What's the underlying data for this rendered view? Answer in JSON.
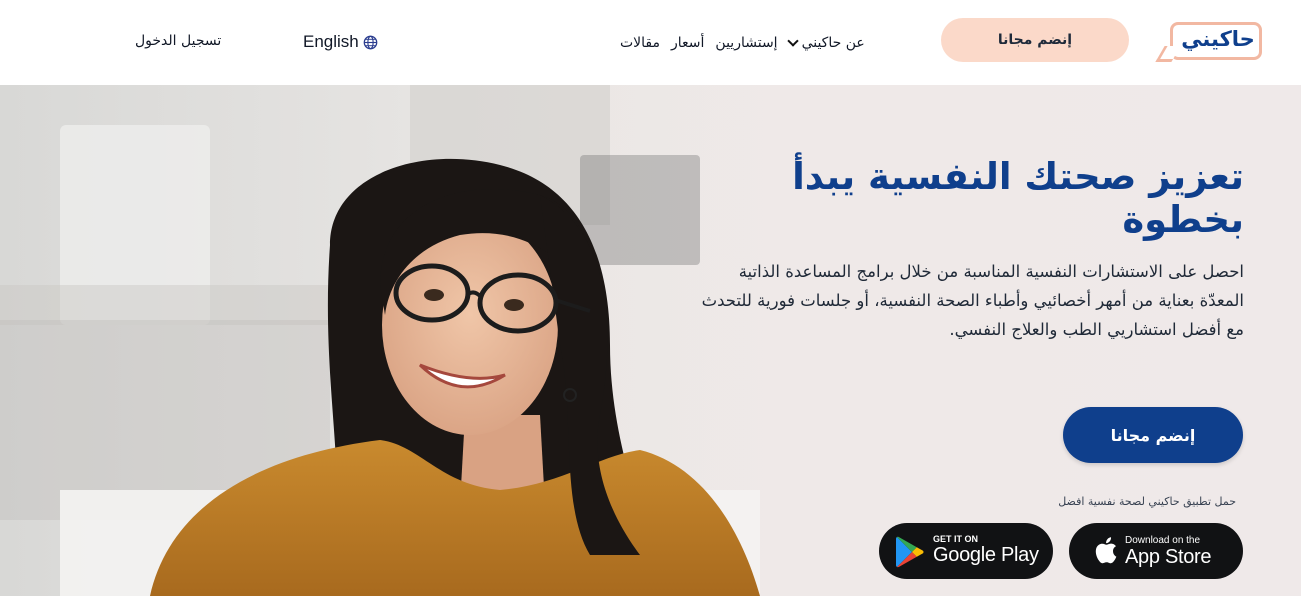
{
  "header": {
    "logo_text": "حاكيني",
    "join_label": "إنضم مجانا",
    "nav": {
      "articles": "مقالات",
      "prices": "أسعار",
      "consultants": "إستشاريين",
      "about": "عن حاكيني"
    },
    "language": "English",
    "login": "تسجيل الدخول"
  },
  "hero": {
    "title": "تعزيز صحتك النفسية يبدأ بخطوة",
    "description": "احصل على الاستشارات النفسية المناسبة من خلال برامج المساعدة الذاتية المعدّة بعناية من أمهر أخصائيي وأطباء الصحة النفسية، أو جلسات فورية للتحدث مع أفضل استشاريي الطب والعلاج النفسي.",
    "join_label": "إنضم مجانا",
    "app_note": "حمل تطبيق حاكيني لصحة نفسية افضل",
    "app_store": {
      "small": "Download on the",
      "big": "App Store"
    },
    "google_play": {
      "small": "GET IT ON",
      "big": "Google Play"
    }
  },
  "colors": {
    "brand_blue": "#0f3f8c",
    "peach": "#fbd9c9",
    "store_black": "#111214"
  },
  "icons": [
    "chevron-down-icon",
    "globe-icon",
    "apple-icon",
    "google-play-icon"
  ]
}
